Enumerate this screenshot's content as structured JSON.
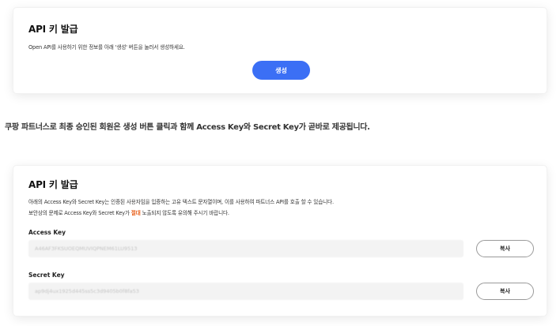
{
  "section1": {
    "title": "API 키 발급",
    "description": "Open API를 사용하기 위한 정보를 아래 '생성' 버튼을 눌러서 생성하세요.",
    "generate_label": "생성"
  },
  "notice": "쿠팡 파트너스로 최종 승인된 회원은 생성 버튼 클릭과 함께 Access Key와 Secret Key가 곧바로 제공됩니다.",
  "section2": {
    "title": "API 키 발급",
    "line1": "아래의 Access Key와 Secret Key는 인증된 사용자임을 입증하는 고유 텍스트 문자열이며, 이를 사용하여 파트너스 API를 호출 할 수 있습니다.",
    "line2_before": "보안상의 문제로 Access Key와 Secret Key가 ",
    "line2_warn": "절대",
    "line2_after": " 노출되지 않도록 유의해 주시기 바랍니다.",
    "access_key": {
      "label": "Access Key",
      "value": "A46AF3FKSUOEQMUVIQPNEM61LU9513",
      "copy_label": "복사"
    },
    "secret_key": {
      "label": "Secret Key",
      "value": "ap9dj4ux1925d445ss5c3d9405b0f8fa53",
      "copy_label": "복사"
    }
  },
  "colors": {
    "primary_button": "#3b6ff5",
    "warning_text": "#e8601c"
  }
}
